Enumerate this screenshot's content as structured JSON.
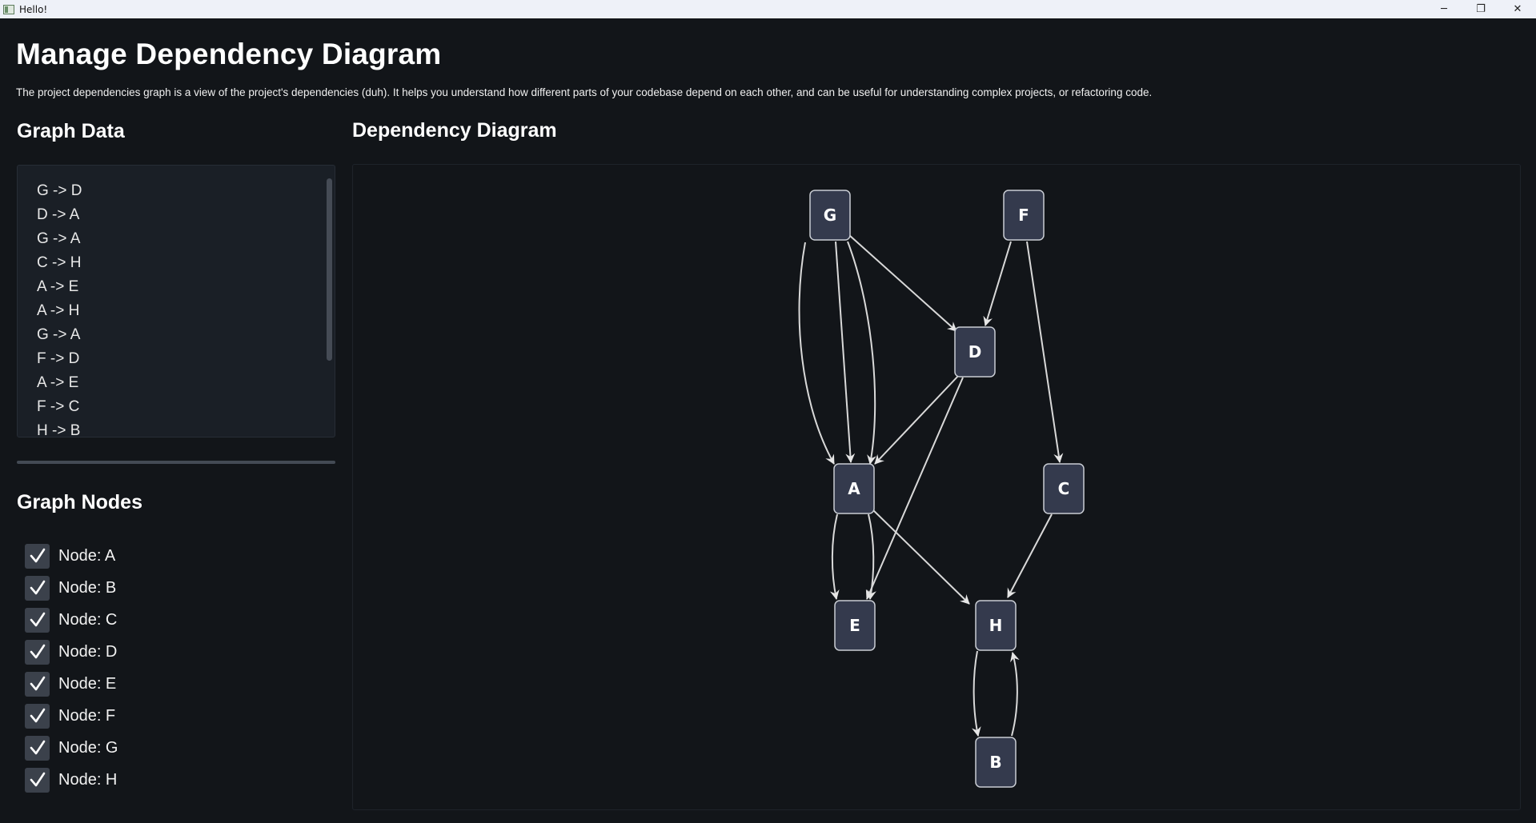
{
  "window": {
    "title": "Hello!",
    "controls": {
      "minimize": "─",
      "restore": "❐",
      "close": "✕"
    }
  },
  "page": {
    "title": "Manage Dependency Diagram",
    "description": "The project dependencies graph is a view of the project's dependencies (duh). It helps you understand how different parts of your codebase depend on each other, and can be useful for understanding complex projects, or refactoring code."
  },
  "graph_data": {
    "heading": "Graph Data",
    "lines": [
      "G -> D",
      "D -> A",
      "G -> A",
      "C -> H",
      "A -> E",
      "A -> H",
      "G -> A",
      "F -> D",
      "A -> E",
      "F -> C",
      "H -> B"
    ]
  },
  "graph_nodes": {
    "heading": "Graph Nodes",
    "items": [
      {
        "label": "Node: A",
        "checked": true
      },
      {
        "label": "Node: B",
        "checked": true
      },
      {
        "label": "Node: C",
        "checked": true
      },
      {
        "label": "Node: D",
        "checked": true
      },
      {
        "label": "Node: E",
        "checked": true
      },
      {
        "label": "Node: F",
        "checked": true
      },
      {
        "label": "Node: G",
        "checked": true
      },
      {
        "label": "Node: H",
        "checked": true
      }
    ]
  },
  "diagram": {
    "heading": "Dependency Diagram",
    "nodes": [
      "G",
      "F",
      "D",
      "A",
      "C",
      "E",
      "H",
      "B"
    ],
    "edges": [
      [
        "G",
        "D"
      ],
      [
        "D",
        "A"
      ],
      [
        "G",
        "A"
      ],
      [
        "C",
        "H"
      ],
      [
        "A",
        "E"
      ],
      [
        "A",
        "H"
      ],
      [
        "G",
        "A"
      ],
      [
        "F",
        "D"
      ],
      [
        "A",
        "E"
      ],
      [
        "F",
        "C"
      ],
      [
        "H",
        "B"
      ],
      [
        "G",
        "A"
      ],
      [
        "D",
        "E"
      ],
      [
        "B",
        "H"
      ]
    ]
  },
  "colors": {
    "background": "#121519",
    "node_fill": "#343a4d",
    "checkbox": "#3b414b"
  }
}
